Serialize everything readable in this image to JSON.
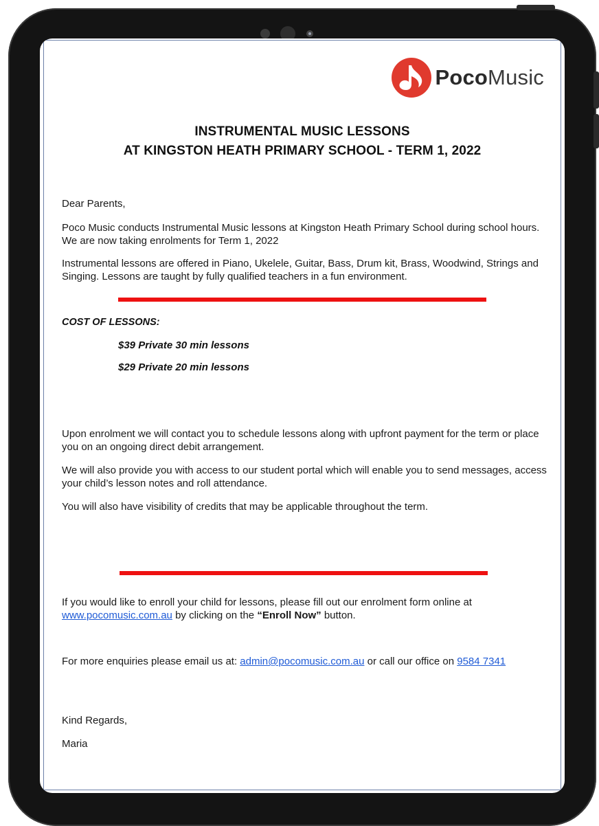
{
  "logo": {
    "brand_bold": "Poco",
    "brand_light": "Music",
    "accent": "#e03a2e"
  },
  "letter": {
    "title_line1": "INSTRUMENTAL MUSIC LESSONS",
    "title_line2": "AT KINGSTON HEATH PRIMARY SCHOOL - TERM  1, 2022",
    "greeting": "Dear Parents,",
    "intro_p1": "Poco Music conducts Instrumental Music lessons at Kingston Heath Primary School during school hours. We are now taking enrolments for Term 1, 2022",
    "intro_p2": "Instrumental lessons are offered in Piano, Ukelele, Guitar, Bass, Drum kit, Brass, Woodwind, Strings and Singing. Lessons are taught by fully qualified teachers in a fun environment.",
    "cost_heading": "COST OF LESSONS:",
    "cost_items": [
      "$39 Private 30 min lessons",
      "$29 Private 20 min lessons"
    ],
    "enrol_p1": "Upon enrolment we will contact you to schedule lessons along with upfront payment for the term or place you on an ongoing direct debit arrangement.",
    "enrol_p2": "We will also provide you with access to our student portal which will enable you to send messages, access your child’s lesson notes and roll attendance.",
    "enrol_p3": "You will also have visibility of credits that may be applicable throughout the term.",
    "cta_before": "If you would like to enroll your child for lessons, please fill out our enrolment form online at ",
    "cta_link": "www.pocomusic.com.au",
    "cta_middle": " by clicking on the ",
    "cta_bold": "“Enroll Now”",
    "cta_after": " button.",
    "enq_before": "For more enquiries please email us at: ",
    "enq_email": "admin@pocomusic.com.au",
    "enq_middle": " or call our office on ",
    "enq_phone": "9584 7341",
    "signoff": "Kind Regards,",
    "signature": "Maria",
    "rule_color": "#ee1111",
    "link_color": "#1f5bd6"
  }
}
